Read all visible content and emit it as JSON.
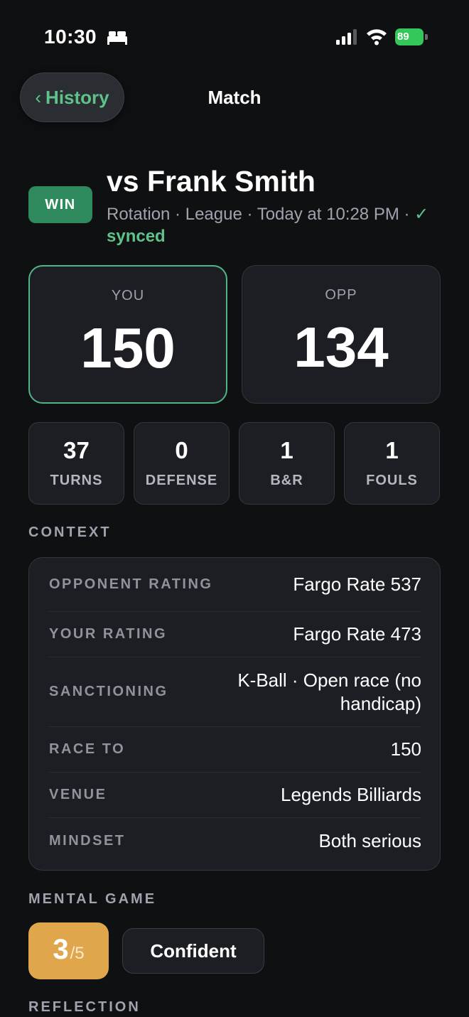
{
  "status_bar": {
    "time": "10:30",
    "battery": "89",
    "battery_color": "#34c759"
  },
  "nav": {
    "back_label": "History",
    "back_chevron": "‹",
    "title": "Match"
  },
  "header": {
    "result": "WIN",
    "opponent": "vs Frank Smith",
    "meta": "Rotation · League · Today at 10:28 PM",
    "sync_prefix": " · ",
    "sync_check": "✓",
    "sync_status": " synced",
    "accent_color": "#5ec28a"
  },
  "scores": {
    "you_label": "YOU",
    "you_value": "150",
    "opp_label": "OPP",
    "opp_value": "134"
  },
  "stats": [
    {
      "value": "37",
      "label": "TURNS"
    },
    {
      "value": "0",
      "label": "DEFENSE"
    },
    {
      "value": "1",
      "label": "B&R"
    },
    {
      "value": "1",
      "label": "FOULS"
    }
  ],
  "context": {
    "title": "CONTEXT",
    "rows": [
      {
        "label": "OPPONENT RATING",
        "value": "Fargo Rate 537"
      },
      {
        "label": "YOUR RATING",
        "value": "Fargo Rate 473"
      },
      {
        "label": "SANCTIONING",
        "value": "K-Ball · Open race (no handicap)"
      },
      {
        "label": "RACE TO",
        "value": "150"
      },
      {
        "label": "VENUE",
        "value": "Legends Billiards"
      },
      {
        "label": "MINDSET",
        "value": "Both serious"
      }
    ]
  },
  "mental_game": {
    "title": "MENTAL GAME",
    "rating": "3",
    "rating_scale": "/5",
    "rating_color": "#e0a64c",
    "mood": "Confident"
  },
  "reflection": {
    "title": "REFLECTION"
  }
}
